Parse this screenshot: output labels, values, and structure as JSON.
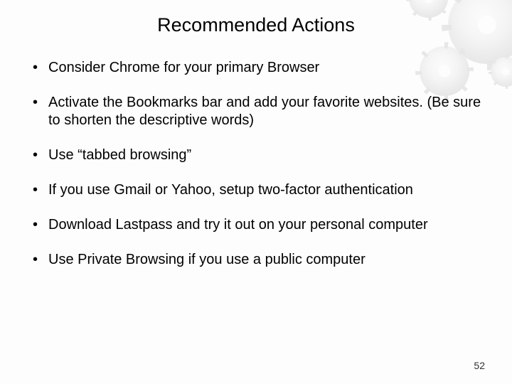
{
  "title": "Recommended Actions",
  "bullets": [
    "Consider Chrome for your primary Browser",
    "Activate the Bookmarks bar and add your favorite websites. (Be sure to shorten the descriptive words)",
    "Use “tabbed browsing”",
    "If you use Gmail or Yahoo, setup two-factor authentication",
    "Download Lastpass and try it out on your personal computer",
    "Use Private Browsing if you use a public computer"
  ],
  "page_number": "52"
}
